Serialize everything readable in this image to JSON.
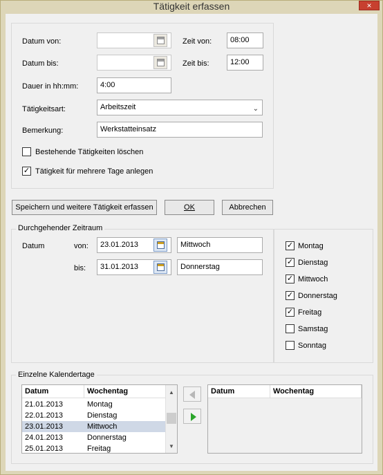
{
  "window": {
    "title": "Tätigkeit erfassen",
    "close_glyph": "×"
  },
  "top": {
    "datum_von_label": "Datum von:",
    "datum_von_value": "",
    "datum_bis_label": "Datum bis:",
    "datum_bis_value": "",
    "zeit_von_label": "Zeit von:",
    "zeit_von_value": "08:00",
    "zeit_bis_label": "Zeit bis:",
    "zeit_bis_value": "12:00",
    "dauer_label": "Dauer in hh:mm:",
    "dauer_value": "4:00",
    "art_label": "Tätigkeitsart:",
    "art_value": "Arbeitszeit",
    "bemerkung_label": "Bemerkung:",
    "bemerkung_value": "Werkstatteinsatz",
    "loeschen_label": "Bestehende Tätigkeiten löschen",
    "loeschen_checked": false,
    "mehrere_label": "Tätigkeit für mehrere Tage anlegen",
    "mehrere_checked": true
  },
  "buttons": {
    "save_more": "Speichern und weitere Tätigkeit erfassen",
    "ok": "OK",
    "cancel": "Abbrechen"
  },
  "zeitraum": {
    "legend": "Durchgehender Zeitraum",
    "datum_label": "Datum",
    "von_label": "von:",
    "von_value": "23.01.2013",
    "von_weekday": "Mittwoch",
    "bis_label": "bis:",
    "bis_value": "31.01.2013",
    "bis_weekday": "Donnerstag"
  },
  "weekdays": [
    {
      "label": "Montag",
      "checked": true
    },
    {
      "label": "Dienstag",
      "checked": true
    },
    {
      "label": "Mittwoch",
      "checked": true
    },
    {
      "label": "Donnerstag",
      "checked": true
    },
    {
      "label": "Freitag",
      "checked": true
    },
    {
      "label": "Samstag",
      "checked": false
    },
    {
      "label": "Sonntag",
      "checked": false
    }
  ],
  "kalendertage": {
    "legend": "Einzelne Kalendertage",
    "col_datum": "Datum",
    "col_wochentag": "Wochentag",
    "rows": [
      {
        "datum": "21.01.2013",
        "wochentag": "Montag"
      },
      {
        "datum": "22.01.2013",
        "wochentag": "Dienstag"
      },
      {
        "datum": "23.01.2013",
        "wochentag": "Mittwoch"
      },
      {
        "datum": "24.01.2013",
        "wochentag": "Donnerstag"
      },
      {
        "datum": "25.01.2013",
        "wochentag": "Freitag"
      }
    ],
    "selected_row": 2
  },
  "colors": {
    "accent_green": "#2aa52a",
    "selection": "#cfd8e6",
    "close_red": "#c7402f"
  }
}
